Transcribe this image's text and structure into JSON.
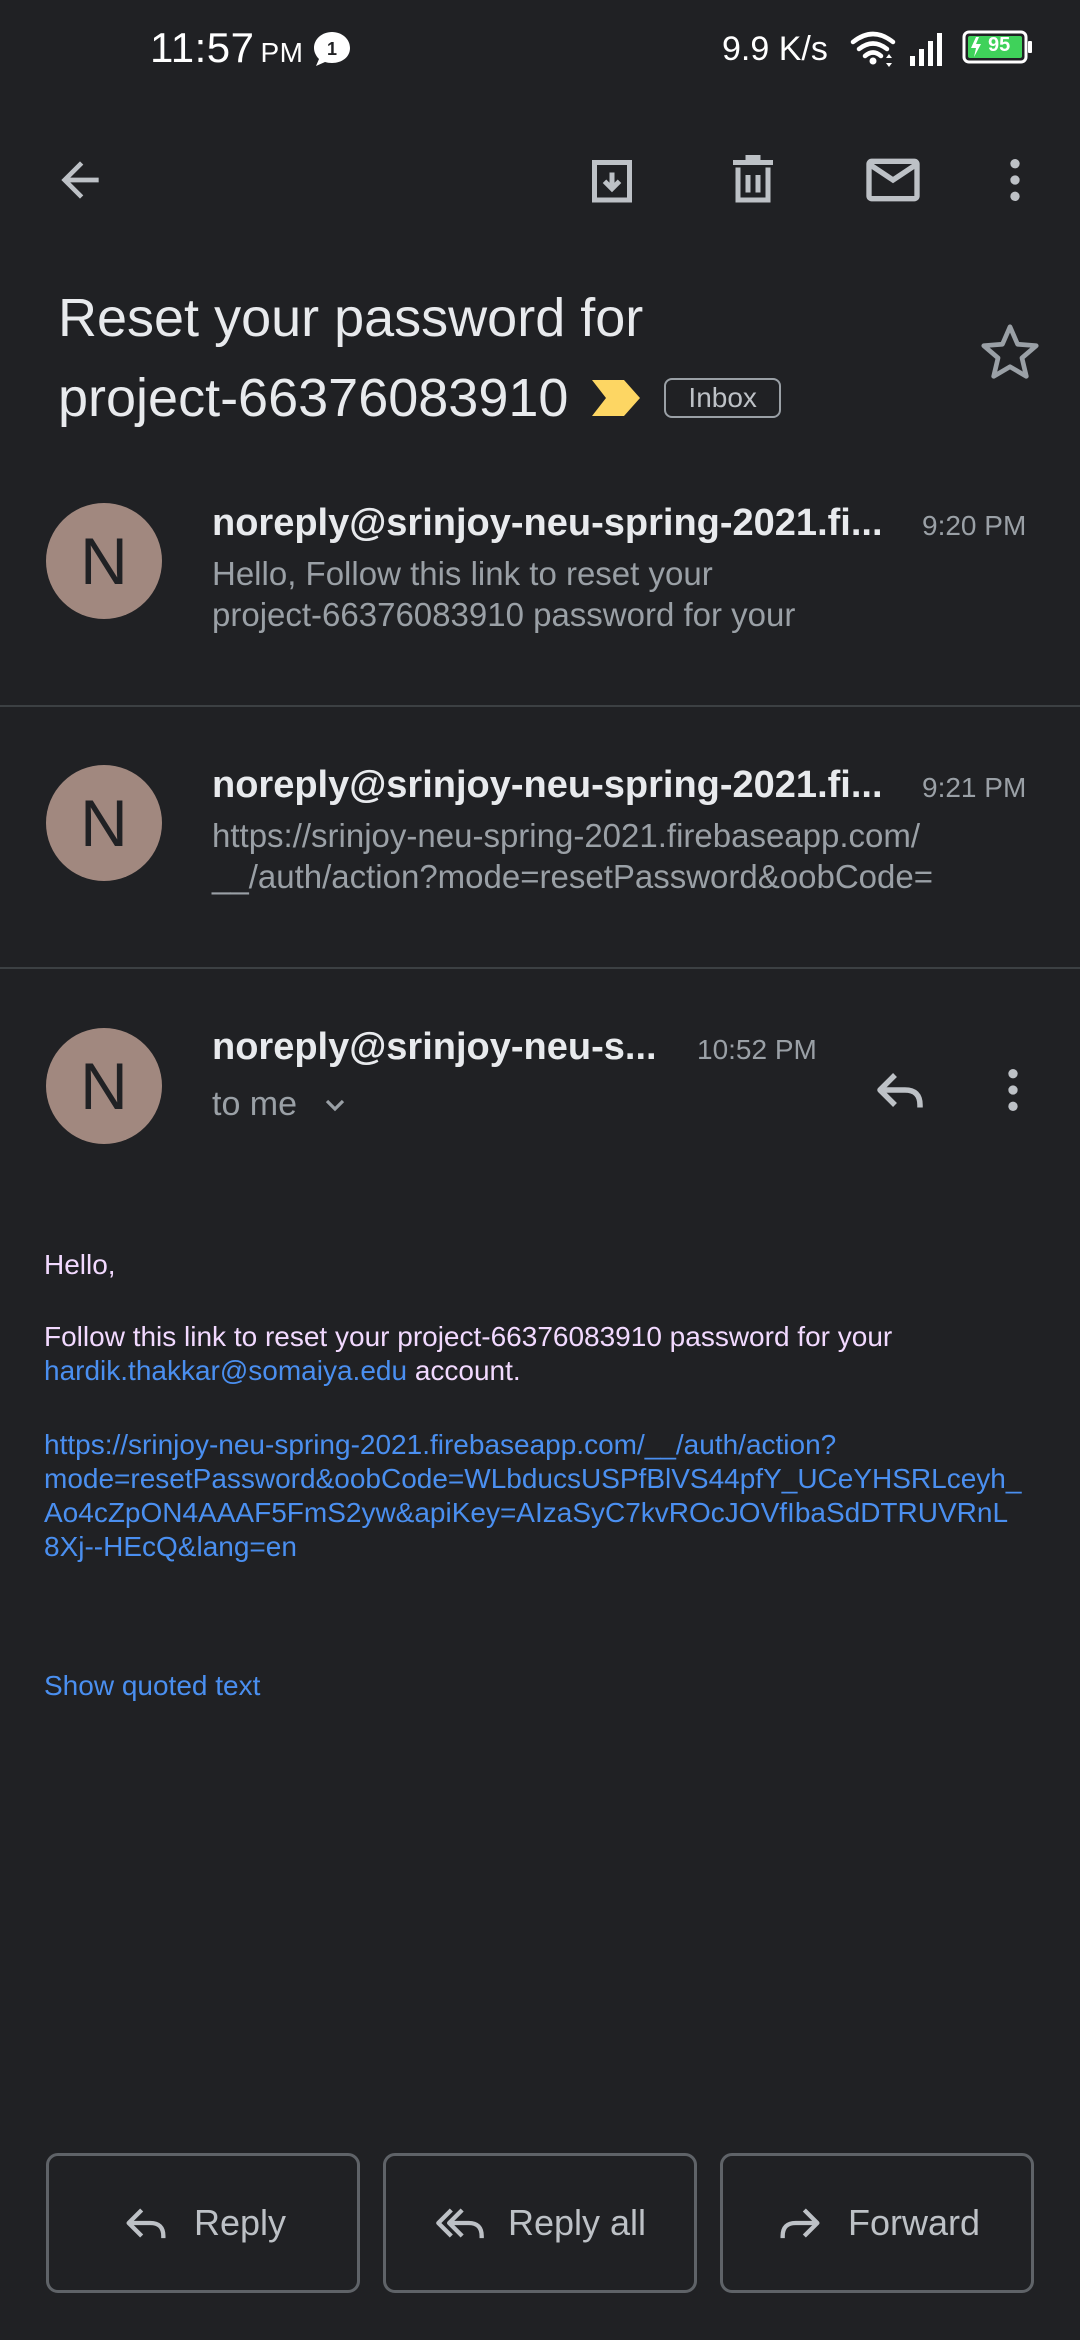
{
  "status_bar": {
    "time": "11:57",
    "ampm": "PM",
    "notification_count": "1",
    "net_speed": "9.9 K/s",
    "battery_level": "95"
  },
  "toolbar": {
    "back_icon": "arrow-left-icon",
    "archive_icon": "archive-icon",
    "delete_icon": "trash-icon",
    "mark_unread_icon": "mail-icon",
    "more_icon": "more-vert-icon"
  },
  "subject": {
    "line1": "Reset your password for",
    "line2": "project-66376083910",
    "label": "Inbox",
    "important_color": "#fdd663"
  },
  "messages": [
    {
      "avatar": "N",
      "sender": "noreply@srinjoy-neu-spring-2021.fi...",
      "time": "9:20 PM",
      "snippet_line1": "Hello, Follow this link to reset your",
      "snippet_line2": "project-66376083910 password for your"
    },
    {
      "avatar": "N",
      "sender": "noreply@srinjoy-neu-spring-2021.fi...",
      "time": "9:21 PM",
      "snippet_line1": "https://srinjoy-neu-spring-2021.firebaseapp.com/",
      "snippet_line2": "__/auth/action?mode=resetPassword&oobCode="
    }
  ],
  "open_message": {
    "avatar": "N",
    "sender": "noreply@srinjoy-neu-s...",
    "time": "10:52 PM",
    "recipient": "to me",
    "greeting": "Hello,",
    "body_prefix": "Follow this link to reset your project-66376083910 password for your",
    "email_link": "hardik.thakkar@somaiya.edu",
    "body_suffix": " account.",
    "url_line1": "https://srinjoy-neu-spring-2021.firebaseapp.com/__/auth/action?",
    "url_line2": "mode=resetPassword&oobCode=WLbducsUSPfBlVS44pfY_UCeYHSRLceyh_",
    "url_line3": "Ao4cZpON4AAAF5FmS2yw&apiKey=AIzaSyC7kvROcJOVfIbaSdDTRUVRnL",
    "url_line4": "8Xj--HEcQ&lang=en",
    "show_quoted": "Show quoted text"
  },
  "actions": {
    "reply": "Reply",
    "reply_all": "Reply all",
    "forward": "Forward"
  },
  "colors": {
    "background": "#202124",
    "link": "#4a8ff0",
    "avatar": "#a1887f",
    "body_text": "#f2d9ff"
  }
}
